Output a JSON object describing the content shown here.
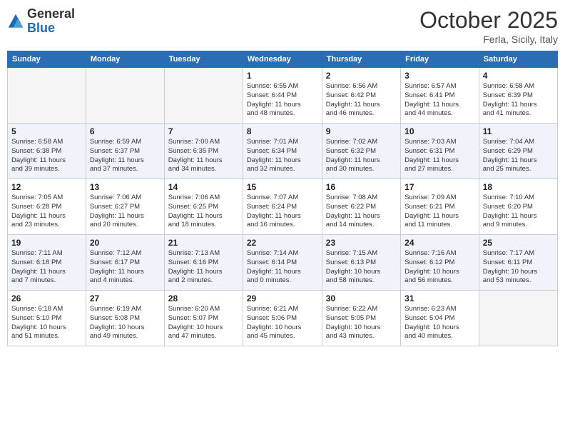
{
  "header": {
    "logo_general": "General",
    "logo_blue": "Blue",
    "month": "October 2025",
    "location": "Ferla, Sicily, Italy"
  },
  "weekdays": [
    "Sunday",
    "Monday",
    "Tuesday",
    "Wednesday",
    "Thursday",
    "Friday",
    "Saturday"
  ],
  "weeks": [
    [
      {
        "day": "",
        "info": ""
      },
      {
        "day": "",
        "info": ""
      },
      {
        "day": "",
        "info": ""
      },
      {
        "day": "1",
        "info": "Sunrise: 6:55 AM\nSunset: 6:44 PM\nDaylight: 11 hours\nand 48 minutes."
      },
      {
        "day": "2",
        "info": "Sunrise: 6:56 AM\nSunset: 6:42 PM\nDaylight: 11 hours\nand 46 minutes."
      },
      {
        "day": "3",
        "info": "Sunrise: 6:57 AM\nSunset: 6:41 PM\nDaylight: 11 hours\nand 44 minutes."
      },
      {
        "day": "4",
        "info": "Sunrise: 6:58 AM\nSunset: 6:39 PM\nDaylight: 11 hours\nand 41 minutes."
      }
    ],
    [
      {
        "day": "5",
        "info": "Sunrise: 6:58 AM\nSunset: 6:38 PM\nDaylight: 11 hours\nand 39 minutes."
      },
      {
        "day": "6",
        "info": "Sunrise: 6:59 AM\nSunset: 6:37 PM\nDaylight: 11 hours\nand 37 minutes."
      },
      {
        "day": "7",
        "info": "Sunrise: 7:00 AM\nSunset: 6:35 PM\nDaylight: 11 hours\nand 34 minutes."
      },
      {
        "day": "8",
        "info": "Sunrise: 7:01 AM\nSunset: 6:34 PM\nDaylight: 11 hours\nand 32 minutes."
      },
      {
        "day": "9",
        "info": "Sunrise: 7:02 AM\nSunset: 6:32 PM\nDaylight: 11 hours\nand 30 minutes."
      },
      {
        "day": "10",
        "info": "Sunrise: 7:03 AM\nSunset: 6:31 PM\nDaylight: 11 hours\nand 27 minutes."
      },
      {
        "day": "11",
        "info": "Sunrise: 7:04 AM\nSunset: 6:29 PM\nDaylight: 11 hours\nand 25 minutes."
      }
    ],
    [
      {
        "day": "12",
        "info": "Sunrise: 7:05 AM\nSunset: 6:28 PM\nDaylight: 11 hours\nand 23 minutes."
      },
      {
        "day": "13",
        "info": "Sunrise: 7:06 AM\nSunset: 6:27 PM\nDaylight: 11 hours\nand 20 minutes."
      },
      {
        "day": "14",
        "info": "Sunrise: 7:06 AM\nSunset: 6:25 PM\nDaylight: 11 hours\nand 18 minutes."
      },
      {
        "day": "15",
        "info": "Sunrise: 7:07 AM\nSunset: 6:24 PM\nDaylight: 11 hours\nand 16 minutes."
      },
      {
        "day": "16",
        "info": "Sunrise: 7:08 AM\nSunset: 6:22 PM\nDaylight: 11 hours\nand 14 minutes."
      },
      {
        "day": "17",
        "info": "Sunrise: 7:09 AM\nSunset: 6:21 PM\nDaylight: 11 hours\nand 11 minutes."
      },
      {
        "day": "18",
        "info": "Sunrise: 7:10 AM\nSunset: 6:20 PM\nDaylight: 11 hours\nand 9 minutes."
      }
    ],
    [
      {
        "day": "19",
        "info": "Sunrise: 7:11 AM\nSunset: 6:18 PM\nDaylight: 11 hours\nand 7 minutes."
      },
      {
        "day": "20",
        "info": "Sunrise: 7:12 AM\nSunset: 6:17 PM\nDaylight: 11 hours\nand 4 minutes."
      },
      {
        "day": "21",
        "info": "Sunrise: 7:13 AM\nSunset: 6:16 PM\nDaylight: 11 hours\nand 2 minutes."
      },
      {
        "day": "22",
        "info": "Sunrise: 7:14 AM\nSunset: 6:14 PM\nDaylight: 11 hours\nand 0 minutes."
      },
      {
        "day": "23",
        "info": "Sunrise: 7:15 AM\nSunset: 6:13 PM\nDaylight: 10 hours\nand 58 minutes."
      },
      {
        "day": "24",
        "info": "Sunrise: 7:16 AM\nSunset: 6:12 PM\nDaylight: 10 hours\nand 56 minutes."
      },
      {
        "day": "25",
        "info": "Sunrise: 7:17 AM\nSunset: 6:11 PM\nDaylight: 10 hours\nand 53 minutes."
      }
    ],
    [
      {
        "day": "26",
        "info": "Sunrise: 6:18 AM\nSunset: 5:10 PM\nDaylight: 10 hours\nand 51 minutes."
      },
      {
        "day": "27",
        "info": "Sunrise: 6:19 AM\nSunset: 5:08 PM\nDaylight: 10 hours\nand 49 minutes."
      },
      {
        "day": "28",
        "info": "Sunrise: 6:20 AM\nSunset: 5:07 PM\nDaylight: 10 hours\nand 47 minutes."
      },
      {
        "day": "29",
        "info": "Sunrise: 6:21 AM\nSunset: 5:06 PM\nDaylight: 10 hours\nand 45 minutes."
      },
      {
        "day": "30",
        "info": "Sunrise: 6:22 AM\nSunset: 5:05 PM\nDaylight: 10 hours\nand 43 minutes."
      },
      {
        "day": "31",
        "info": "Sunrise: 6:23 AM\nSunset: 5:04 PM\nDaylight: 10 hours\nand 40 minutes."
      },
      {
        "day": "",
        "info": ""
      }
    ]
  ]
}
